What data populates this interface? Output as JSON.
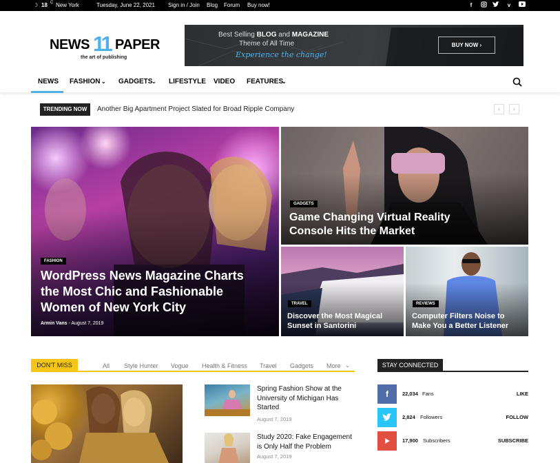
{
  "topbar": {
    "weather_temp": "18",
    "weather_unit": "C",
    "city": "New York",
    "date": "Tuesday, June 22, 2021",
    "links": [
      "Sign in / Join",
      "Blog",
      "Forum",
      "Buy now!"
    ],
    "social_icons": [
      "facebook-icon",
      "instagram-icon",
      "twitter-icon",
      "vimeo-icon",
      "youtube-icon"
    ]
  },
  "header": {
    "logo_left": "NEWS",
    "logo_number": "11",
    "logo_right": "PAPER",
    "logo_tagline": "the art of publishing"
  },
  "banner": {
    "line1_pre": "Best Selling ",
    "line1_b1": "BLOG",
    "line1_mid": " and ",
    "line1_b2": "MAGAZINE",
    "line2": "Theme of All Time",
    "line3": "Experience the change!",
    "button": "BUY NOW ›"
  },
  "nav": {
    "items": [
      "NEWS",
      "FASHION",
      "GADGETS",
      "LIFESTYLE",
      "VIDEO",
      "FEATURES"
    ],
    "active": "NEWS",
    "accent": "#4db2ec"
  },
  "trending": {
    "label": "TRENDING NOW",
    "headline": "Another Big Apartment Project Slated for Broad Ripple Company"
  },
  "featured": {
    "main": {
      "category": "FASHION",
      "title": "WordPress News Magazine Charts the Most Chic and Fashionable Women of New York City",
      "author": "Armin Vans",
      "date": "August 7, 2019"
    },
    "top_right": {
      "category": "GADGETS",
      "title": "Game Changing Virtual Reality Console Hits the Market"
    },
    "bottom_left": {
      "category": "TRAVEL",
      "title": "Discover the Most Magical Sunset in Santorini"
    },
    "bottom_right": {
      "category": "REVIEWS",
      "title": "Computer Filters Noise to Make You a Better Listener"
    }
  },
  "dont_miss": {
    "label": "DON'T MISS",
    "tabs": [
      "All",
      "Style Hunter",
      "Vogue",
      "Health & Fitness",
      "Travel",
      "Gadgets",
      "More"
    ],
    "accent": "#f5c518",
    "posts": [
      {
        "title": "Spring Fashion Show at the University of Michigan Has Started",
        "date": "August 7, 2019"
      },
      {
        "title": "Study 2020: Fake Engagement is Only Half the Problem",
        "date": "August 7, 2019"
      }
    ]
  },
  "stay_connected": {
    "label": "STAY CONNECTED",
    "rows": [
      {
        "icon": "facebook-icon",
        "count": "22,034",
        "label": "Fans",
        "action": "LIKE",
        "color": "#516eab"
      },
      {
        "icon": "twitter-icon",
        "count": "2,824",
        "label": "Followers",
        "action": "FOLLOW",
        "color": "#29c5f6"
      },
      {
        "icon": "youtube-icon",
        "count": "17,900",
        "label": "Subscribers",
        "action": "SUBSCRIBE",
        "color": "#e14e42"
      }
    ]
  }
}
